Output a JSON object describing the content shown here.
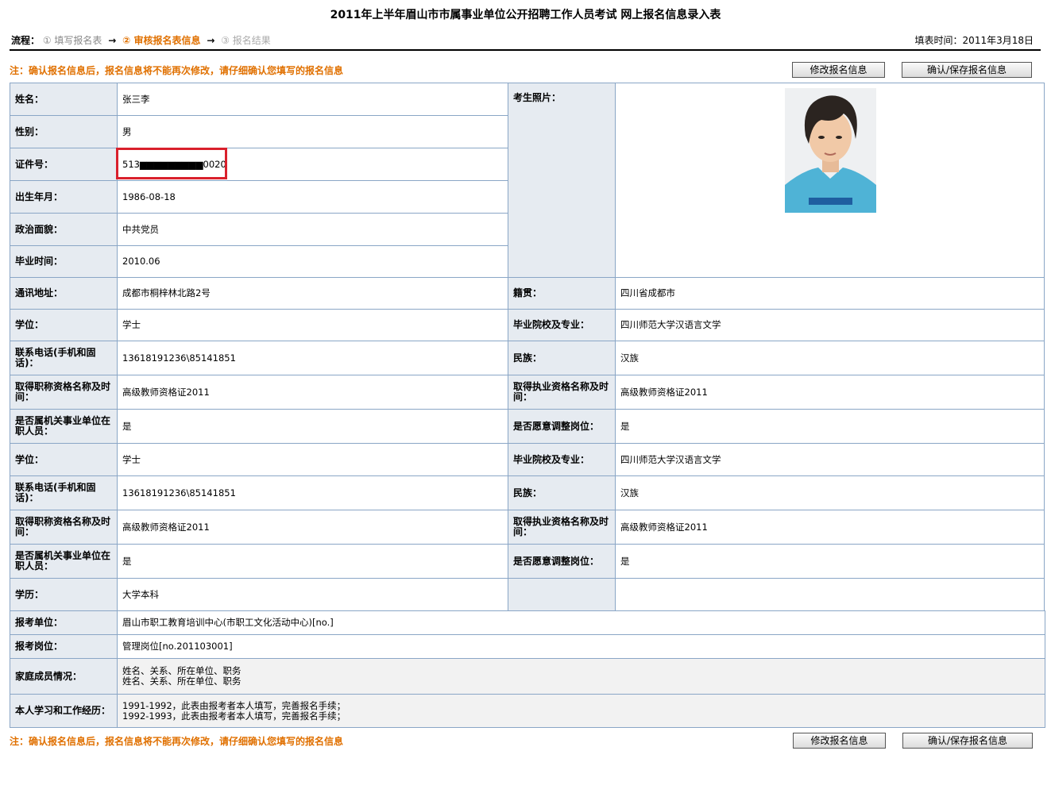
{
  "title": "2011年上半年眉山市市属事业单位公开招聘工作人员考试 网上报名信息录入表",
  "flow": {
    "label": "流程：",
    "steps": [
      "① 填写报名表",
      "② 审核报名表信息",
      "③ 报名结果"
    ],
    "arrow": "→",
    "fill_time": "填表时间：2011年3月18日"
  },
  "note": "注：确认报名信息后，报名信息将不能再次修改，请仔细确认您填写的报名信息",
  "buttons": {
    "modify": "修改报名信息",
    "confirm": "确认/保存报名信息"
  },
  "photo_label": "考生照片：",
  "top_rows": [
    {
      "label": "姓名：",
      "value": "张三李"
    },
    {
      "label": "性别：",
      "value": "男"
    },
    {
      "label": "证件号：",
      "value": "513▆▆▆▆▆▆▆▆▆0020"
    },
    {
      "label": "出生年月：",
      "value": "1986-08-18"
    },
    {
      "label": "政治面貌：",
      "value": "中共党员"
    },
    {
      "label": "毕业时间：",
      "value": "2010.06"
    }
  ],
  "grid_rows": [
    {
      "l1": "通讯地址：",
      "v1": "成都市桐梓林北路2号",
      "l2": "籍贯：",
      "v2": "四川省成都市"
    },
    {
      "l1": "学位：",
      "v1": "学士",
      "l2": "毕业院校及专业：",
      "v2": "四川师范大学汉语言文学"
    },
    {
      "l1": "联系电话(手机和固话)：",
      "v1": "13618191236\\85141851",
      "l2": "民族：",
      "v2": "汉族"
    },
    {
      "l1": "取得职称资格名称及时间：",
      "v1": "高级教师资格证2011",
      "l2": "取得执业资格名称及时间：",
      "v2": "高级教师资格证2011"
    },
    {
      "l1": "是否属机关事业单位在职人员：",
      "v1": "是",
      "l2": "是否愿意调整岗位：",
      "v2": "是"
    },
    {
      "l1": "学位：",
      "v1": "学士",
      "l2": "毕业院校及专业：",
      "v2": "四川师范大学汉语言文学"
    },
    {
      "l1": "联系电话(手机和固话)：",
      "v1": "13618191236\\85141851",
      "l2": "民族：",
      "v2": "汉族"
    },
    {
      "l1": "取得职称资格名称及时间：",
      "v1": "高级教师资格证2011",
      "l2": "取得执业资格名称及时间：",
      "v2": "高级教师资格证2011"
    },
    {
      "l1": "是否属机关事业单位在职人员：",
      "v1": "是",
      "l2": "是否愿意调整岗位：",
      "v2": "是"
    },
    {
      "l1": "学历：",
      "v1": "大学本科",
      "l2": "",
      "v2": ""
    }
  ],
  "apply": {
    "unit_label": "报考单位：",
    "unit_value": "眉山市职工教育培训中心(市职工文化活动中心)[no.]",
    "post_label": "报考岗位：",
    "post_value": "管理岗位[no.201103001]"
  },
  "family": {
    "label": "家庭成员情况：",
    "lines": [
      "姓名、关系、所在单位、职务",
      "姓名、关系、所在单位、职务"
    ]
  },
  "history": {
    "label": "本人学习和工作经历：",
    "lines": [
      "1991-1992，此表由报考者本人填写，完善报名手续；",
      "1992-1993，此表由报考者本人填写，完善报名手续；"
    ]
  }
}
